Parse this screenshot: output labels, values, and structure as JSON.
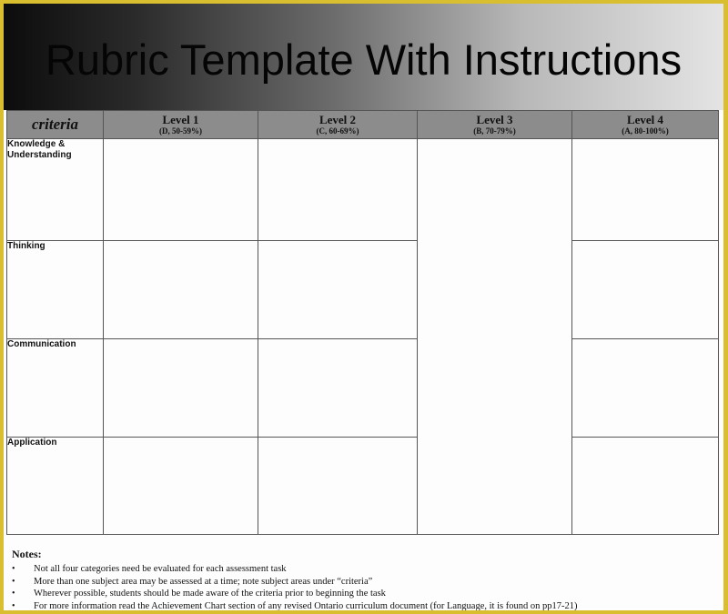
{
  "title": "Rubric Template With Instructions",
  "colors": {
    "frame_border": "#d9bf2f",
    "header_row_bg": "#8c8c8c",
    "banner_gradient_start": "#0c0c0c",
    "banner_gradient_end": "#e4e4e4"
  },
  "table": {
    "criteria_header": "criteria",
    "levels": [
      {
        "name": "Level 1",
        "range": "(D, 50-59%)"
      },
      {
        "name": "Level 2",
        "range": "(C, 60-69%)"
      },
      {
        "name": "Level 3",
        "range": "(B, 70-79%)"
      },
      {
        "name": "Level 4",
        "range": "(A, 80-100%)"
      }
    ],
    "rows": [
      {
        "label_line1": "Knowledge &",
        "label_line2": "Understanding"
      },
      {
        "label_line1": "Thinking",
        "label_line2": ""
      },
      {
        "label_line1": "Communication",
        "label_line2": ""
      },
      {
        "label_line1": "Application",
        "label_line2": ""
      }
    ]
  },
  "notes": {
    "title": "Notes:",
    "bullet_glyph": "•",
    "items": [
      "Not all four categories need be evaluated for each assessment task",
      "More than one subject area may be assessed at a time; note subject areas under “criteria”",
      "Wherever possible, students should be made aware of the criteria prior to beginning the task",
      "For more information read the Achievement Chart section of any revised Ontario curriculum document (for Language, it is found on pp17-21)"
    ]
  }
}
